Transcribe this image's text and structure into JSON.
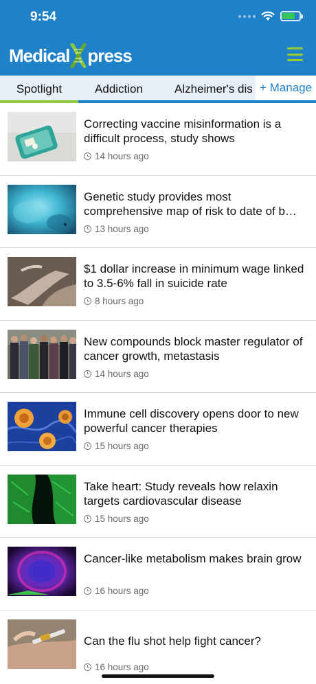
{
  "status_bar": {
    "time": "9:54"
  },
  "app": {
    "logo_left": "Medical",
    "logo_x": "X",
    "logo_right": "press",
    "brand_color": "#1f82c8",
    "accent_color": "#8dc63f"
  },
  "tabs": [
    {
      "label": "Spotlight",
      "selected": true
    },
    {
      "label": "Addiction",
      "selected": false
    },
    {
      "label": "Alzheimer's dis",
      "selected": false
    }
  ],
  "manage_label": "+ Manage",
  "articles": [
    {
      "headline": "Correcting vaccine misinformation is a difficult process, study shows",
      "time": "14 hours ago",
      "thumb": "vaccine-card-image"
    },
    {
      "headline": "Genetic study provides most comprehensive map of risk to date of b…",
      "time": "13 hours ago",
      "thumb": "blue-tissue-image"
    },
    {
      "headline": "$1 dollar increase in minimum wage linked to 3.5-6% fall in suicide rate",
      "time": "8 hours ago",
      "thumb": "hands-image"
    },
    {
      "headline": "New compounds block master regulator of cancer growth, metastasis",
      "time": "14 hours ago",
      "thumb": "research-group-photo"
    },
    {
      "headline": "Immune cell discovery opens door to new powerful cancer therapies",
      "time": "15 hours ago",
      "thumb": "cells-illustration"
    },
    {
      "headline": "Take heart: Study reveals how relaxin targets cardiovascular disease",
      "time": "15 hours ago",
      "thumb": "green-fluorescent-image"
    },
    {
      "headline": "Cancer-like metabolism makes brain grow",
      "time": "16 hours ago",
      "thumb": "purple-fluorescent-image"
    },
    {
      "headline": "Can the flu shot help fight cancer?",
      "time": "16 hours ago",
      "thumb": "injection-image"
    }
  ]
}
